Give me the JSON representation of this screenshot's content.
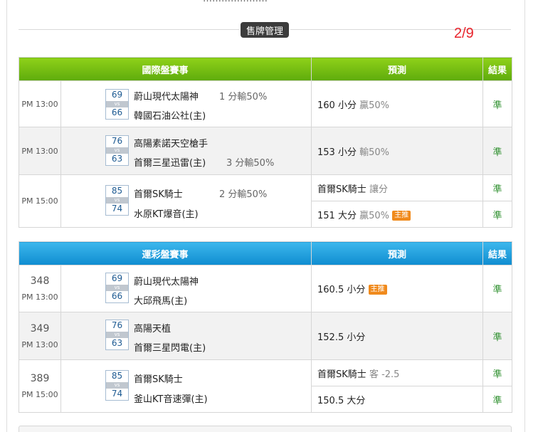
{
  "header": {
    "top_text": "…………………",
    "admin_button": "售牌管理",
    "page_number": "2/9"
  },
  "columns": {
    "prediction": "預測",
    "result": "結果"
  },
  "section1": {
    "title": "國際盤賽事",
    "rows": [
      {
        "time": "PM 13:00",
        "score1": "69",
        "vs": "vs",
        "score2": "66",
        "team1": "蔚山現代太陽神",
        "team2": "韓國石油公社(主)",
        "odds": "1 分輸50%",
        "predictions": [
          {
            "main": "160 小分",
            "sub": "贏50%",
            "tag": ""
          }
        ],
        "results": [
          "準"
        ]
      },
      {
        "time": "PM 13:00",
        "score1": "76",
        "vs": "vs",
        "score2": "63",
        "team1": "高陽素諾天空槍手",
        "team2": "首爾三星迅雷(主)",
        "odds": "3 分輸50%",
        "predictions": [
          {
            "main": "153 小分",
            "sub": "輸50%",
            "tag": ""
          }
        ],
        "results": [
          "準"
        ]
      },
      {
        "time": "PM 15:00",
        "score1": "85",
        "vs": "vs",
        "score2": "74",
        "team1": "首爾SK騎士",
        "team2": "水原KT爆音(主)",
        "odds": "2 分輸50%",
        "predictions": [
          {
            "main": "首爾SK騎士",
            "sub": "讓分",
            "tag": ""
          },
          {
            "main": "151 大分",
            "sub": "贏50%",
            "tag": "主推"
          }
        ],
        "results": [
          "準",
          "準"
        ]
      }
    ]
  },
  "section2": {
    "title": "運彩盤賽事",
    "rows": [
      {
        "num": "348",
        "time": "PM 13:00",
        "score1": "69",
        "vs": "vs",
        "score2": "66",
        "team1": "蔚山現代太陽神",
        "team2": "大邱飛馬(主)",
        "predictions": [
          {
            "main": "160.5 小分",
            "sub": "",
            "tag": "主推"
          }
        ],
        "results": [
          "準"
        ]
      },
      {
        "num": "349",
        "time": "PM 13:00",
        "score1": "76",
        "vs": "vs",
        "score2": "63",
        "team1": "高陽天植",
        "team2": "首爾三星閃電(主)",
        "predictions": [
          {
            "main": "152.5 小分",
            "sub": "",
            "tag": ""
          }
        ],
        "results": [
          "準"
        ]
      },
      {
        "num": "389",
        "time": "PM 15:00",
        "score1": "85",
        "vs": "vs",
        "score2": "74",
        "team1": "首爾SK騎士",
        "team2": "釜山KT音速彈(主)",
        "predictions": [
          {
            "main": "首爾SK騎士",
            "sub": "客 -2.5",
            "tag": ""
          },
          {
            "main": "150.5 大分",
            "sub": "",
            "tag": ""
          }
        ],
        "results": [
          "準",
          "準"
        ]
      }
    ]
  },
  "colors": {
    "green_header": "#6fbd10",
    "blue_header": "#1b9be0",
    "page_number": "#e8232b",
    "result": "#2d8f2d"
  }
}
